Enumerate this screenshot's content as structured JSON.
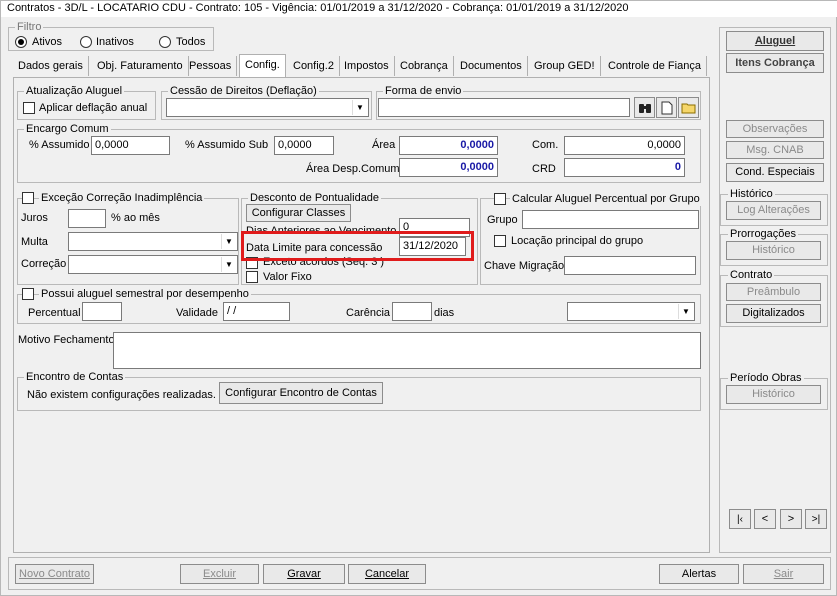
{
  "window": {
    "title": "Contratos - 3D/L - LOCATARIO CDU - Contrato: 105 - Vigência: 01/01/2019 a 31/12/2020 - Cobrança: 01/01/2019 a 31/12/2020"
  },
  "filter": {
    "label": "Filtro",
    "options": [
      "Ativos",
      "Inativos",
      "Todos"
    ],
    "selected": "Ativos"
  },
  "tabs": [
    "Dados gerais",
    "Obj. Faturamento",
    "Pessoas",
    "Config.",
    "Config.2",
    "Impostos",
    "Cobrança",
    "Documentos",
    "Group GED!",
    "Controle de Fiança"
  ],
  "active_tab": "Config.",
  "atualizacao": {
    "legend": "Atualização Aluguel",
    "checkbox_label": "Aplicar deflação anual"
  },
  "cessao": {
    "legend": "Cessão de Direitos (Deflação)",
    "value": ""
  },
  "forma_envio": {
    "legend": "Forma de envio",
    "value": ""
  },
  "encargo": {
    "legend": "Encargo Comum",
    "assumido_label": "% Assumido",
    "assumido_value": "0,0000",
    "assumido_sub_label": "% Assumido Sub",
    "assumido_sub_value": "0,0000",
    "area_label": "Área",
    "area_value": "0,0000",
    "area_desp_label": "Área Desp.Comum",
    "area_desp_value": "0,0000",
    "com_label": "Com.",
    "com_value": "0,0000",
    "crd_label": "CRD",
    "crd_value": "0"
  },
  "excecao": {
    "checkbox_label": "Exceção Correção Inadimplência",
    "juros_label": "Juros",
    "juros_value": "",
    "juros_unit": "% ao mês",
    "multa_label": "Multa",
    "correcao_label": "Correção"
  },
  "desconto": {
    "legend": "Desconto de Pontualidade",
    "configurar_button": "Configurar Classes",
    "dias_label": "Dias Anteriores ao Vencimento",
    "dias_value": "0",
    "data_limite_label": "Data Limite para concessão",
    "data_limite_value": "31/12/2020",
    "exceto_label": "Exceto acordos (Seq. 3 )",
    "valor_fixo_label": "Valor Fixo"
  },
  "calcular": {
    "checkbox_label": "Calcular Aluguel Percentual por Grupo",
    "grupo_label": "Grupo",
    "grupo_value": "",
    "locacao_label": "Locação principal do grupo",
    "chave_label": "Chave Migração",
    "chave_value": ""
  },
  "semestral": {
    "checkbox_label": "Possui aluguel semestral por desempenho",
    "percentual_label": "Percentual",
    "percentual_value": "",
    "validade_label": "Validade",
    "validade_value": " /  /",
    "carencia_label": "Carência",
    "carencia_value": "",
    "dias_label": "dias"
  },
  "motivo": {
    "label": "Motivo Fechamento",
    "value": ""
  },
  "encontro": {
    "legend": "Encontro de Contas",
    "text": "Não existem configurações realizadas.",
    "button": "Configurar Encontro de Contas"
  },
  "side": {
    "aluguel": "Aluguel",
    "itens_cobranca": "Itens Cobrança",
    "observacoes": "Observações",
    "msg_cnab": "Msg. CNAB",
    "cond_especiais": "Cond. Especiais",
    "historico_legend": "Histórico",
    "log_alteracoes": "Log Alterações",
    "prorrogacoes_legend": "Prorrogações",
    "prorrogacoes_historico": "Histórico",
    "contrato_legend": "Contrato",
    "preambulo": "Preâmbulo",
    "digitalizados": "Digitalizados",
    "periodo_legend": "Período Obras",
    "periodo_historico": "Histórico",
    "nav": [
      "K",
      "<",
      ">",
      ">|"
    ]
  },
  "footer": {
    "novo_contrato": "Novo Contrato",
    "excluir": "Excluir",
    "gravar": "Gravar",
    "cancelar": "Cancelar",
    "alertas": "Alertas",
    "sair": "Sair"
  },
  "colors": {
    "highlight_box": "#e01b1b",
    "value_blue": "#1a1aa6"
  }
}
